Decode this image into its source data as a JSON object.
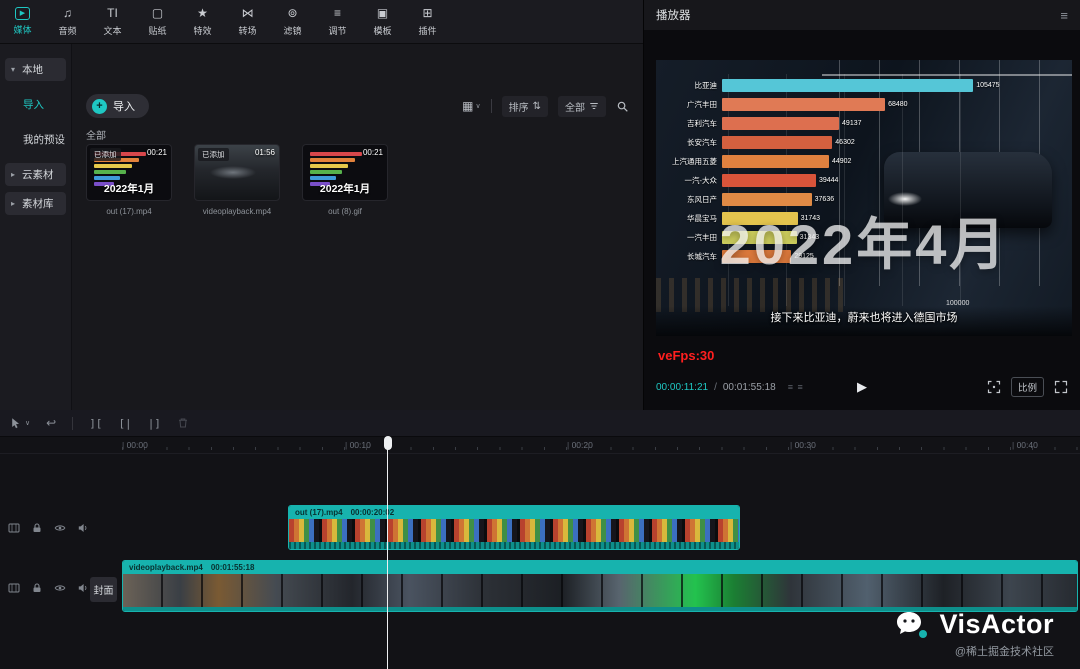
{
  "colors": {
    "accent": "#1fc8c3",
    "fps_red": "#ff1f1f",
    "clip_teal": "#16b3ad"
  },
  "glyphs": {
    "hamburger": "≡",
    "play": "▶",
    "undo": "↩",
    "grid_view": "▦",
    "caret_down": "∨",
    "sort_arrows": "⇅",
    "frame_strip": "≡ ≡",
    "split": "][",
    "trim_left": "[|",
    "trim_right": "|]",
    "import_plus": "+"
  },
  "top_tabs": {
    "items": [
      {
        "label": "媒体",
        "glyph": "▶"
      },
      {
        "label": "音频",
        "glyph": "♫"
      },
      {
        "label": "文本",
        "glyph": "TI"
      },
      {
        "label": "贴纸",
        "glyph": "▢"
      },
      {
        "label": "特效",
        "glyph": "★"
      },
      {
        "label": "转场",
        "glyph": "⋈"
      },
      {
        "label": "滤镜",
        "glyph": "⊚"
      },
      {
        "label": "调节",
        "glyph": "≡"
      },
      {
        "label": "模板",
        "glyph": "▣"
      },
      {
        "label": "插件",
        "glyph": "⊞"
      }
    ]
  },
  "sidebar": {
    "items": [
      {
        "caret": "▾",
        "label": "本地"
      },
      {
        "caret": "",
        "label": "导入"
      },
      {
        "caret": "",
        "label": "我的预设"
      },
      {
        "caret": "▸",
        "label": "云素材"
      },
      {
        "caret": "▸",
        "label": "素材库"
      }
    ]
  },
  "media_panel": {
    "import_label": "导入",
    "section_label": "全部",
    "sort_label": "排序",
    "filter_label": "全部",
    "items": [
      {
        "badge": "已添加",
        "duration": "00:21",
        "overlay": "2022年1月",
        "name": "out (17).mp4"
      },
      {
        "badge": "已添加",
        "duration": "01:56",
        "overlay": "",
        "name": "videoplayback.mp4"
      },
      {
        "badge": "",
        "duration": "00:21",
        "overlay": "2022年1月",
        "name": "out (8).gif"
      }
    ]
  },
  "player": {
    "title": "播放器",
    "vefps": "veFps:30",
    "current_time": "00:00:11:21",
    "time_separator": "/",
    "total_time": "00:01:55:18",
    "ratio_label": "比例"
  },
  "video_overlay": {
    "big_text": "2022年4月",
    "subtitle": "接下来比亚迪，蔚来也将进入德国市场",
    "axis_max": "100000"
  },
  "chart_data": {
    "type": "bar",
    "orientation": "horizontal",
    "categories": [
      "比亚迪",
      "广汽丰田",
      "吉利汽车",
      "长安汽车",
      "上汽通用五菱",
      "一汽-大众",
      "东风日产",
      "华晨宝马",
      "一汽丰田",
      "长城汽车"
    ],
    "values": [
      105475,
      68480,
      49137,
      46302,
      44902,
      39444,
      37636,
      31743,
      31343,
      29125
    ],
    "bar_colors": [
      "#55c6d7",
      "#e07a55",
      "#dd6f4f",
      "#d4603f",
      "#e0813f",
      "#d9543a",
      "#e08a45",
      "#e3c44e",
      "#cfd05e",
      "#de7a3c"
    ],
    "xlim": [
      0,
      110000
    ],
    "xlabel": "",
    "ylabel": "",
    "legend_visible": false,
    "grid": true
  },
  "timeline": {
    "ruler_labels": [
      "00:00",
      "00:10",
      "00:20",
      "00:30",
      "00:40"
    ],
    "cover_button": "封面",
    "clips": [
      {
        "label": "out (17).mp4",
        "duration": "00:00:20:02"
      },
      {
        "label": "videoplayback.mp4",
        "duration": "00:01:55:18"
      }
    ]
  },
  "watermark": {
    "brand": "VisActor",
    "community": "@稀土掘金技术社区"
  }
}
